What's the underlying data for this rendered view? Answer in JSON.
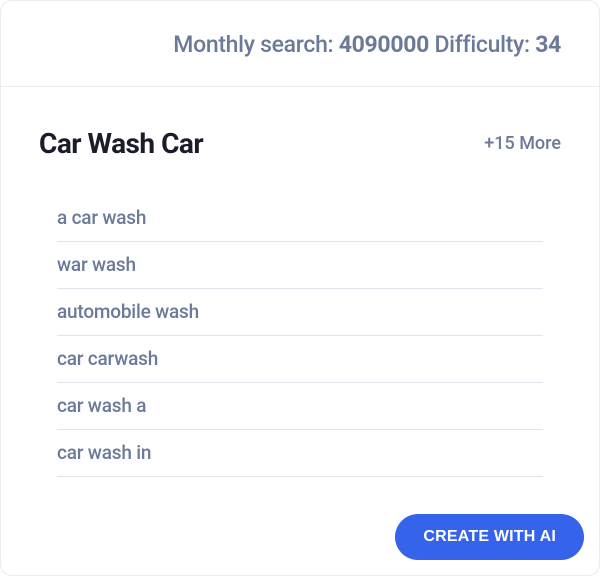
{
  "header": {
    "monthly_search_label": "Monthly search: ",
    "monthly_search_value": "4090000",
    "difficulty_label": " Difficulty: ",
    "difficulty_value": "34"
  },
  "main": {
    "title": "Car Wash Car",
    "more_text": "+15 More",
    "keywords": [
      "a car wash",
      "war wash",
      "automobile wash",
      "car carwash",
      "car wash a",
      "car wash in"
    ]
  },
  "button": {
    "create_label": "CREATE WITH AI"
  }
}
